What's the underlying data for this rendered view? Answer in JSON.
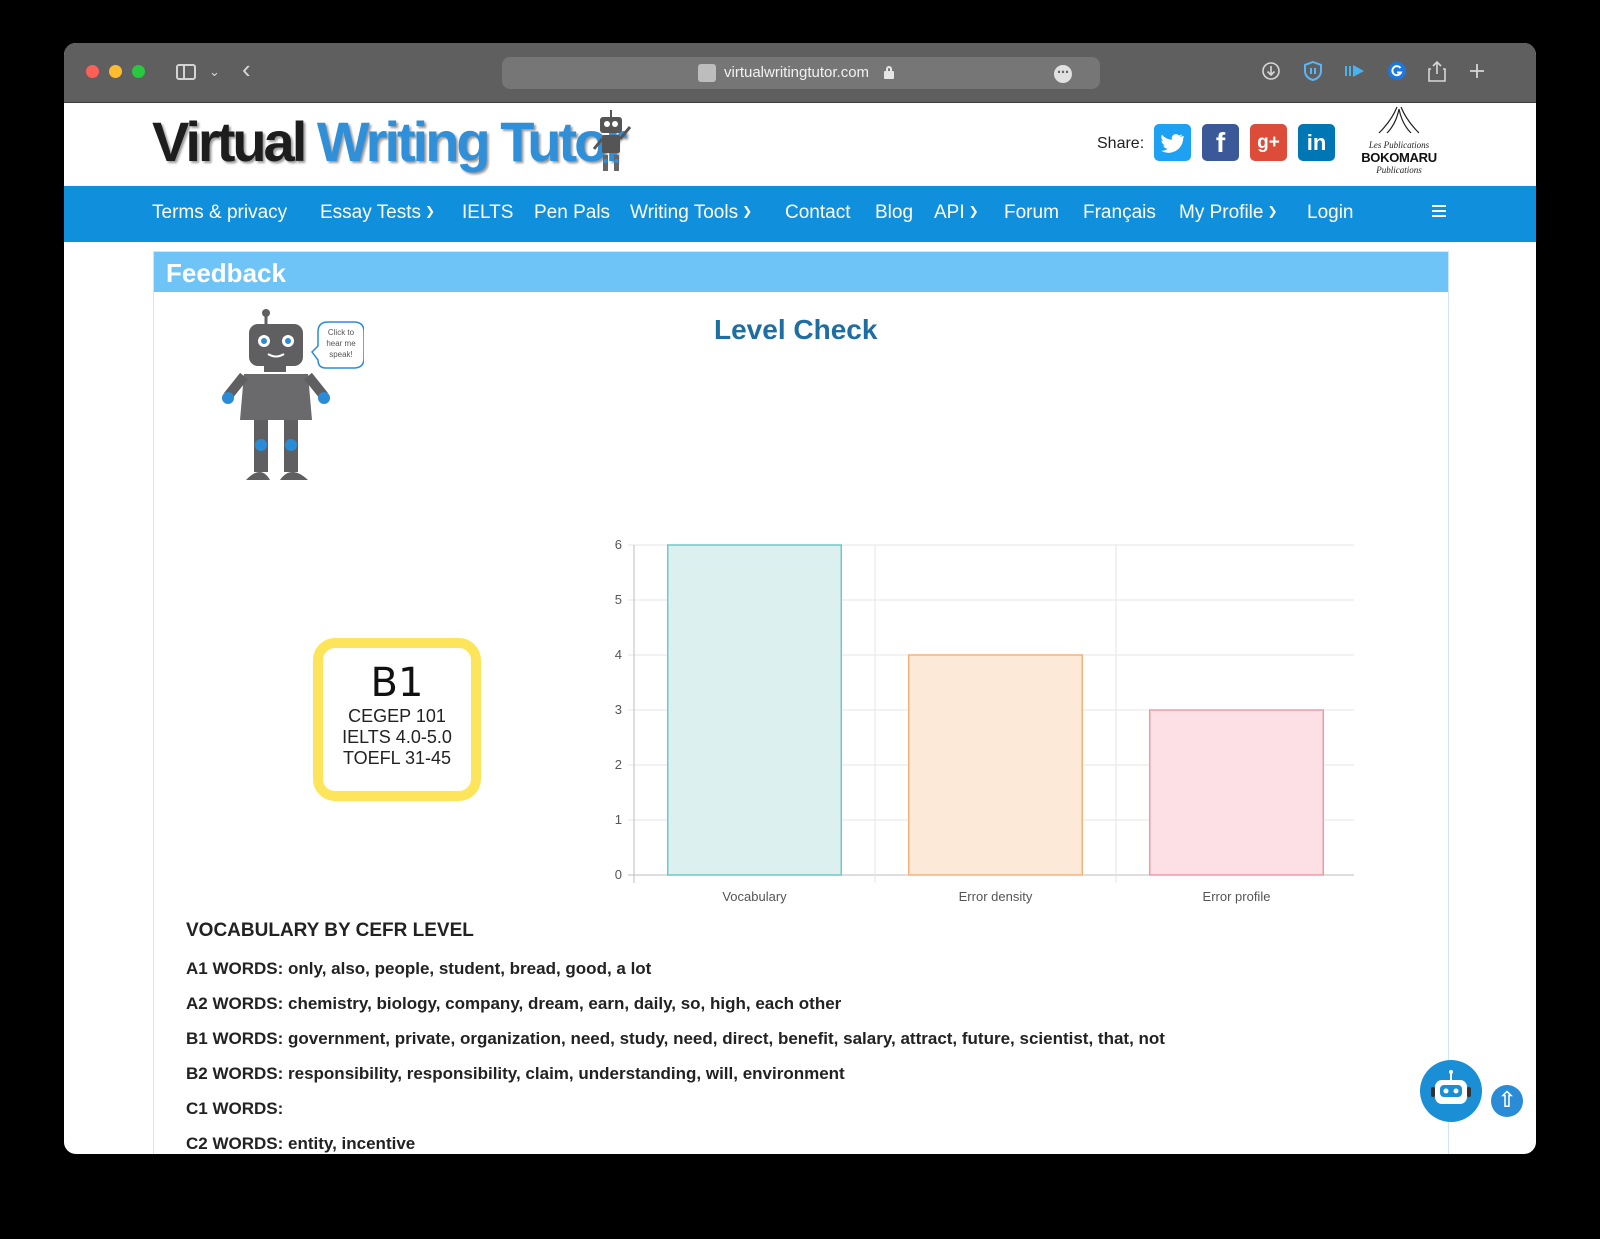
{
  "browser": {
    "url": "virtualwritingtutor.com",
    "secure": true
  },
  "site": {
    "logo_word1": "Virtual",
    "logo_word2": "Writing Tutor",
    "share_label": "Share:",
    "social": [
      "twitter",
      "facebook",
      "google-plus",
      "linkedin"
    ],
    "publisher": {
      "top": "Les Publications",
      "name": "BOKOMARU",
      "bottom": "Publications"
    }
  },
  "nav": {
    "items": [
      {
        "label": "Terms & privacy",
        "dropdown": false
      },
      {
        "label": "Essay Tests",
        "dropdown": true
      },
      {
        "label": "IELTS",
        "dropdown": false
      },
      {
        "label": "Pen Pals",
        "dropdown": false
      },
      {
        "label": "Writing Tools",
        "dropdown": true
      },
      {
        "label": "Contact",
        "dropdown": false
      },
      {
        "label": "Blog",
        "dropdown": false
      },
      {
        "label": "API",
        "dropdown": true
      },
      {
        "label": "Forum",
        "dropdown": false
      },
      {
        "label": "Français",
        "dropdown": false
      },
      {
        "label": "My Profile",
        "dropdown": true
      },
      {
        "label": "Login",
        "dropdown": false
      }
    ]
  },
  "feedback": {
    "title": "Feedback",
    "heading": "Level Check",
    "robot_bubble": [
      "Click to",
      "hear me",
      "speak!"
    ],
    "badge": {
      "level": "B1",
      "lines": [
        "CEGEP 101",
        "IELTS 4.0-5.0",
        "TOEFL 31-45"
      ]
    }
  },
  "chart_data": {
    "type": "bar",
    "categories": [
      "Vocabulary",
      "Error density",
      "Error profile"
    ],
    "values": [
      6,
      4,
      3
    ],
    "ylim": [
      0,
      6
    ],
    "yticks": [
      "0",
      "1",
      "2",
      "3",
      "4",
      "5",
      "6"
    ],
    "grid": true,
    "colors": {
      "fill": [
        "#dcf1ef",
        "#fde9d8",
        "#fde0e5"
      ],
      "stroke": [
        "#6cc9c7",
        "#f3b27a",
        "#ee99a8"
      ]
    }
  },
  "vocabulary": {
    "title": "VOCABULARY BY CEFR LEVEL",
    "levels": [
      {
        "label": "A1 WORDS:",
        "words": "only, also, people, student, bread, good, a lot"
      },
      {
        "label": "A2 WORDS:",
        "words": "chemistry, biology, company, dream, earn, daily, so, high, each other"
      },
      {
        "label": "B1 WORDS:",
        "words": "government, private, organization, need, study, need, direct, benefit, salary, attract, future, scientist, that, not"
      },
      {
        "label": "B2 WORDS:",
        "words": "responsibility, responsibility, claim, understanding, will, environment"
      },
      {
        "label": "C1 WORDS:",
        "words": ""
      },
      {
        "label": "C2 WORDS:",
        "words": "entity, incentive"
      }
    ]
  }
}
